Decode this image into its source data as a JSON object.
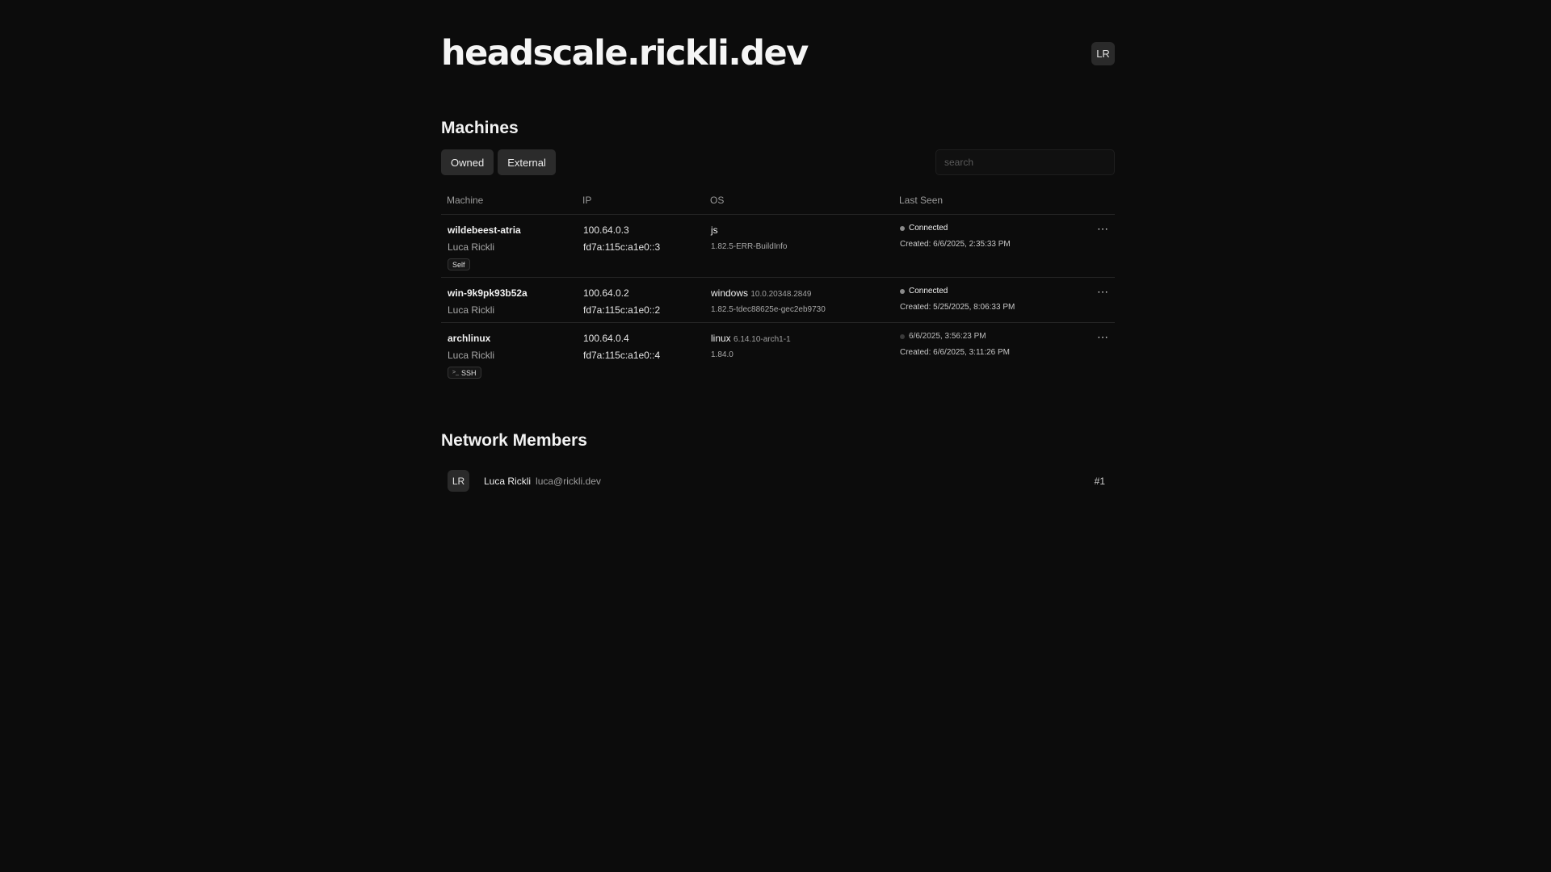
{
  "header": {
    "title": "headscale.rickli.dev",
    "avatar_initials": "LR"
  },
  "machines": {
    "title": "Machines",
    "filters": [
      "Owned",
      "External"
    ],
    "search_placeholder": "search",
    "columns": [
      "Machine",
      "IP",
      "OS",
      "Last Seen"
    ],
    "rows": [
      {
        "name": "wildebeest-atria",
        "owner": "Luca Rickli",
        "tag": "Self",
        "tag_icon": "",
        "ipv4": "100.64.0.3",
        "ipv6": "fd7a:115c:a1e0::3",
        "os": "js",
        "os_version": "",
        "client_version": "1.82.5-ERR-BuildInfo",
        "status": "Connected",
        "online": true,
        "created": "Created: 6/6/2025, 2:35:33 PM"
      },
      {
        "name": "win-9k9pk93b52a",
        "owner": "Luca Rickli",
        "tag": "",
        "tag_icon": "",
        "ipv4": "100.64.0.2",
        "ipv6": "fd7a:115c:a1e0::2",
        "os": "windows",
        "os_version": "10.0.20348.2849",
        "client_version": "1.82.5-tdec88625e-gec2eb9730",
        "status": "Connected",
        "online": true,
        "created": "Created: 5/25/2025, 8:06:33 PM"
      },
      {
        "name": "archlinux",
        "owner": "Luca Rickli",
        "tag": "SSH",
        "tag_icon": ">_",
        "ipv4": "100.64.0.4",
        "ipv6": "fd7a:115c:a1e0::4",
        "os": "linux",
        "os_version": "6.14.10-arch1-1",
        "client_version": "1.84.0",
        "status": "6/6/2025, 3:56:23 PM",
        "online": false,
        "created": "Created: 6/6/2025, 3:11:26 PM"
      }
    ]
  },
  "members": {
    "title": "Network Members",
    "list": [
      {
        "initials": "LR",
        "name": "Luca Rickli",
        "email": "luca@rickli.dev",
        "index": "#1"
      }
    ]
  },
  "icons": {
    "status_dot": "status-dot-icon",
    "more": "more-icon",
    "terminal": "terminal-icon"
  },
  "colors": {
    "background": "#0c0c0c",
    "button": "#2b2b2b",
    "online_dot": "#8a8a8a",
    "offline_dot": "#3a3a3a"
  }
}
